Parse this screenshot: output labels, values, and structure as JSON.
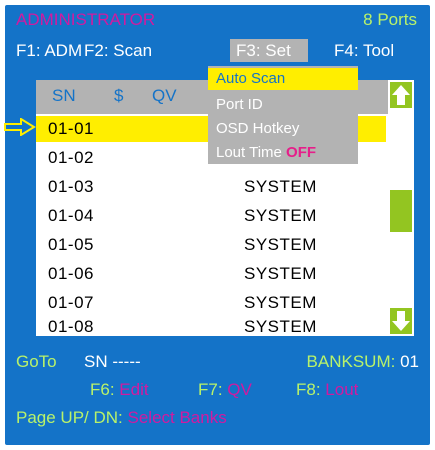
{
  "header": {
    "title": "ADMINISTRATOR",
    "ports": "8 Ports"
  },
  "fkeys": {
    "f1": "F1: ADM",
    "f2": "F2: Scan",
    "f3": "F3: Set",
    "f4": "F4: Tool"
  },
  "columns": {
    "sn": "SN",
    "dollar": "$",
    "qv": "QV"
  },
  "rows": [
    {
      "sn": "01-01",
      "name": ""
    },
    {
      "sn": "01-02",
      "name": ""
    },
    {
      "sn": "01-03",
      "name": "SYSTEM"
    },
    {
      "sn": "01-04",
      "name": "SYSTEM"
    },
    {
      "sn": "01-05",
      "name": "SYSTEM"
    },
    {
      "sn": "01-06",
      "name": "SYSTEM"
    },
    {
      "sn": "01-07",
      "name": "SYSTEM"
    },
    {
      "sn": "01-08",
      "name": "SYSTEM"
    }
  ],
  "menu": {
    "items": [
      "Auto Scan",
      "Port ID",
      "OSD Hotkey",
      "Lout Time"
    ],
    "lout_value": "OFF"
  },
  "footer": {
    "goto_label": "GoTo",
    "sn_field": "SN -----",
    "banksum_label": "BANKSUM:",
    "banksum_value": "01",
    "f6_key": "F6:",
    "f6_label": "Edit",
    "f7_key": "F7:",
    "f7_label": "QV",
    "f8_key": "F8:",
    "f8_label": "Lout",
    "page_label": "Page UP/ DN:",
    "page_value": "Select Banks"
  },
  "icons": [
    "pointer-arrow-icon",
    "scroll-up-icon",
    "scroll-down-icon"
  ],
  "colors": {
    "background": "#1473c8",
    "highlight": "#ffee00",
    "scrollbar": "#93c521",
    "accent": "#d21aa0",
    "label": "#b8f26a"
  }
}
